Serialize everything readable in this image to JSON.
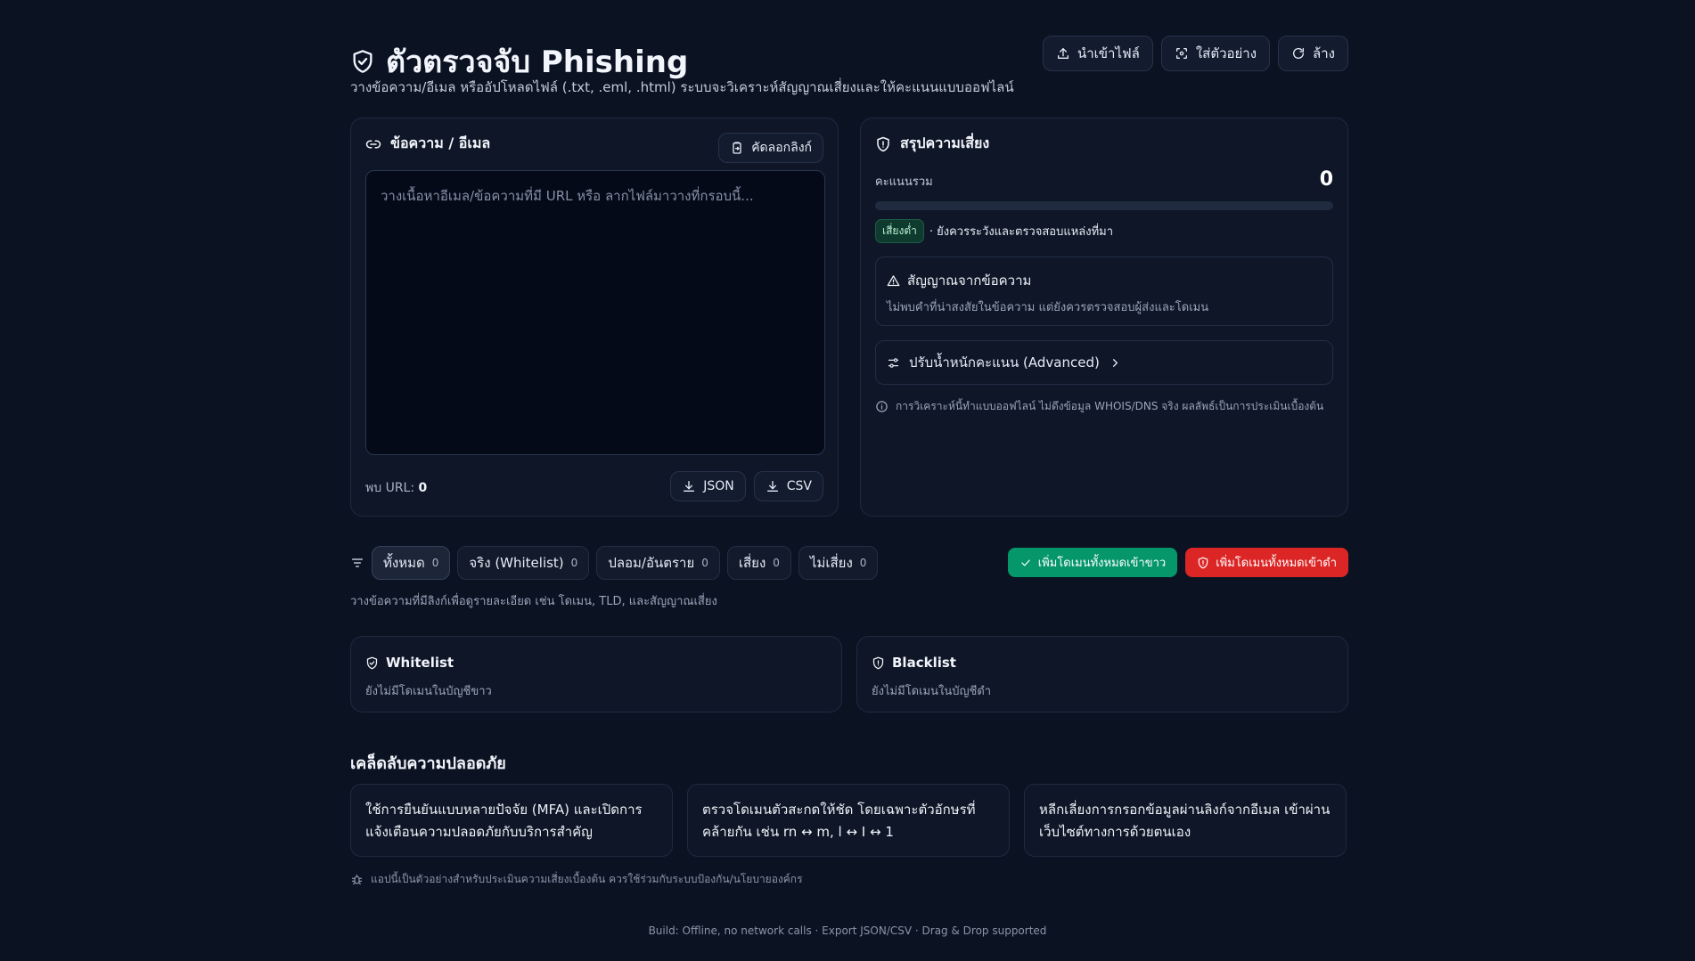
{
  "header": {
    "title": "ตัวตรวจจับ Phishing",
    "subtitle": "วางข้อความ/อีเมล หรืออัปโหลดไฟล์ (.txt, .eml, .html) ระบบจะวิเคราะห์สัญญาณเสี่ยงและให้คะแนนแบบออฟไลน์",
    "import_label": "นำเข้าไฟล์",
    "sample_label": "ใส่ตัวอย่าง",
    "clear_label": "ล้าง"
  },
  "input": {
    "heading": "ข้อความ / อีเมล",
    "copy_links_label": "คัดลอกลิงก์",
    "placeholder": "วางเนื้อหาอีเมล/ข้อความที่มี URL หรือ ลากไฟล์มาวางที่กรอบนี้...",
    "url_count_label": "พบ URL: ",
    "url_count": "0",
    "export_json_label": "JSON",
    "export_csv_label": "CSV"
  },
  "summary": {
    "heading": "สรุปความเสี่ยง",
    "score_label": "คะแนนรวม",
    "score": "0",
    "score_fraction": 0,
    "risk_badge": "เสี่ยงต่ำ",
    "risk_text": "· ยังควรระวังและตรวจสอบแหล่งที่มา",
    "signal_title": "สัญญาณจากข้อความ",
    "signal_desc": "ไม่พบคำที่น่าสงสัยในข้อความ แต่ยังควรตรวจสอบผู้ส่งและโดเมน",
    "advanced_label": "ปรับน้ำหนักคะแนน (Advanced)",
    "note": "การวิเคราะห์นี้ทำแบบออฟไลน์ ไม่ดึงข้อมูล WHOIS/DNS จริง ผลลัพธ์เป็นการประเมินเบื้องต้น"
  },
  "filters": {
    "items": [
      {
        "label": "ทั้งหมด",
        "count": "0"
      },
      {
        "label": "จริง (Whitelist)",
        "count": "0"
      },
      {
        "label": "ปลอม/อันตราย",
        "count": "0"
      },
      {
        "label": "เสี่ยง",
        "count": "0"
      },
      {
        "label": "ไม่เสี่ยง",
        "count": "0"
      }
    ],
    "whitelist_all_label": "เพิ่มโดเมนทั้งหมดเข้าขาว",
    "blacklist_all_label": "เพิ่มโดเมนทั้งหมดเข้าดำ",
    "hint": "วางข้อความที่มีลิงก์เพื่อดูรายละเอียด เช่น โดเมน, TLD, และสัญญาณเสี่ยง"
  },
  "lists": {
    "whitelist_title": "Whitelist",
    "whitelist_empty": "ยังไม่มีโดเมนในบัญชีขาว",
    "blacklist_title": "Blacklist",
    "blacklist_empty": "ยังไม่มีโดเมนในบัญชีดำ"
  },
  "tips": {
    "heading": "เคล็ดลับความปลอดภัย",
    "items": [
      "ใช้การยืนยันแบบหลายปัจจัย (MFA) และเปิดการแจ้งเตือนความปลอดภัยกับบริการสำคัญ",
      "ตรวจโดเมนตัวสะกดให้ชัด โดยเฉพาะตัวอักษรที่คล้ายกัน เช่น rn ↔ m, l ↔ I ↔ 1",
      "หลีกเลี่ยงการกรอกข้อมูลผ่านลิงก์จากอีเมล เข้าผ่านเว็บไซต์ทางการด้วยตนเอง"
    ]
  },
  "disclaimer": "แอปนี้เป็นตัวอย่างสำหรับประเมินความเสี่ยงเบื้องต้น ควรใช้ร่วมกับระบบป้องกัน/นโยบายองค์กร",
  "footer": "Build: Offline, no network calls · Export JSON/CSV · Drag & Drop supported",
  "colors": {
    "background": "#0b1222",
    "card": "#0e1627",
    "green": "#059669",
    "red": "#dc2626",
    "low_risk": "#16a34a"
  }
}
